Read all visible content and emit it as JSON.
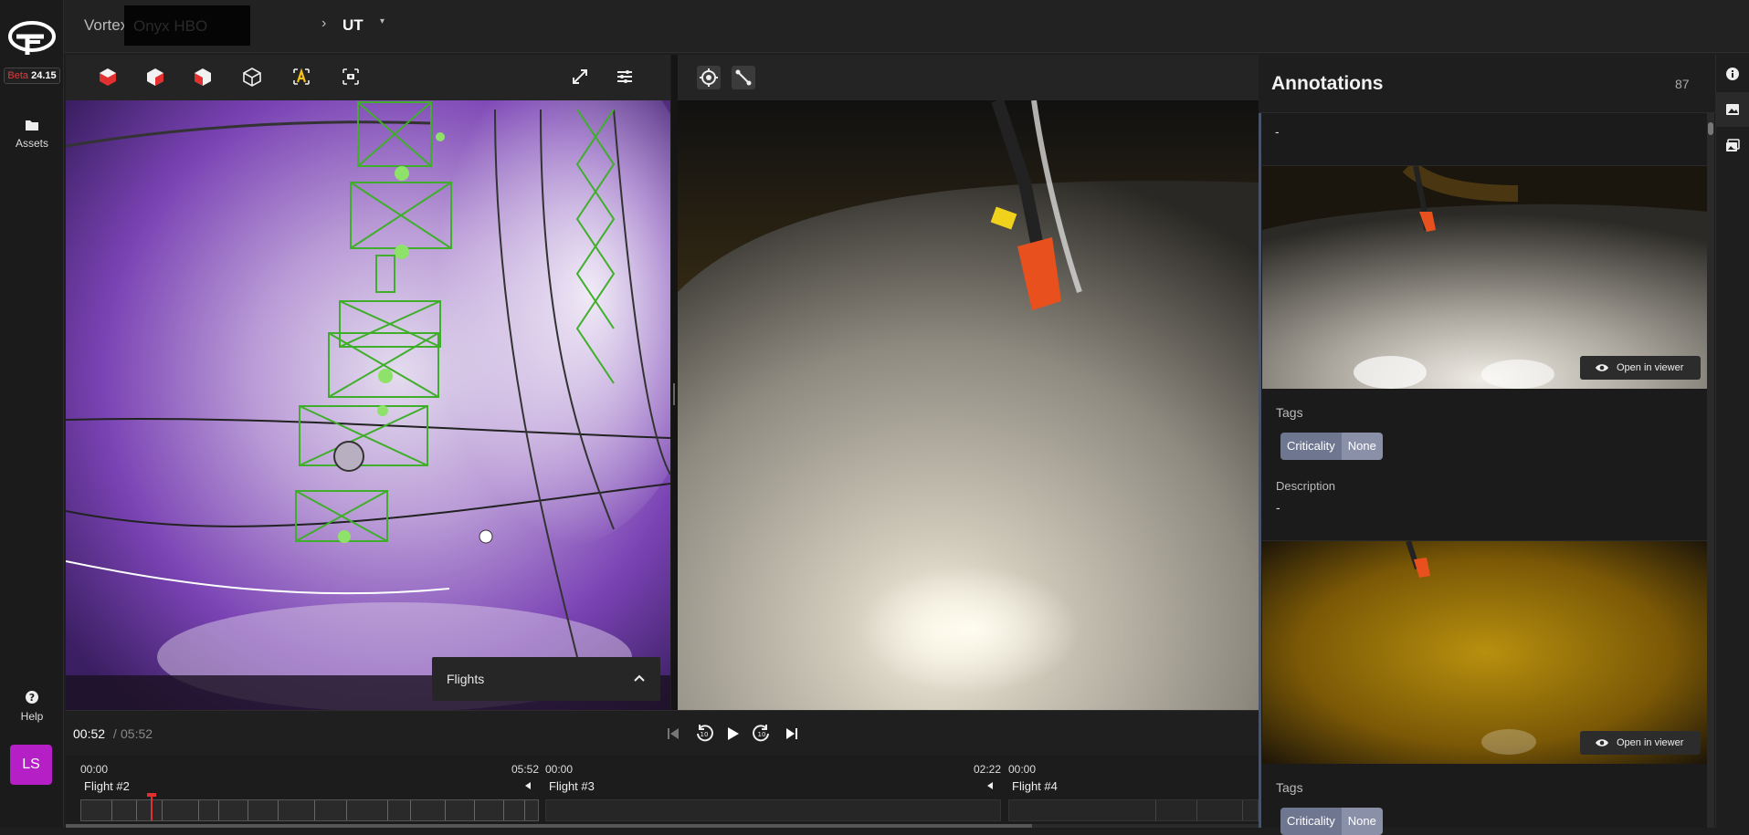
{
  "app": {
    "beta_label": "Beta",
    "version": "24.15"
  },
  "nav": {
    "assets_label": "Assets",
    "help_label": "Help",
    "avatar_initials": "LS"
  },
  "breadcrumb": {
    "item1": "Vortex",
    "item2": "Onyx HBO",
    "item3": "UT"
  },
  "viewer": {
    "flights_panel_label": "Flights"
  },
  "playback": {
    "current_time": "00:52",
    "separator": " / ",
    "total_time": "05:52"
  },
  "timeline": {
    "tracks": [
      {
        "start": "00:00",
        "end": "05:52",
        "name": "Flight #2"
      },
      {
        "start": "00:00",
        "end": "02:22",
        "name": "Flight #3"
      },
      {
        "start": "00:00",
        "end": "",
        "name": "Flight #4"
      }
    ]
  },
  "annotations": {
    "title": "Annotations",
    "count": "87",
    "top_dash": "-",
    "open_in_viewer": "Open in viewer",
    "tags_label": "Tags",
    "tag_key": "Criticality",
    "tag_value": "None",
    "description_label": "Description",
    "description_value": "-"
  },
  "colors": {
    "accent_avatar": "#b51fc6",
    "beta_red": "#e03b3b",
    "tag_key_bg": "#6f7690",
    "tag_value_bg": "#8a90a8",
    "overlay_green": "#3fae2a"
  },
  "icons": [
    "logo-icon",
    "folder-icon",
    "help-icon",
    "cube-icon",
    "expand-icon",
    "sliders-icon",
    "target-icon",
    "measure-icon",
    "camera-icon",
    "eye-icon",
    "info-icon",
    "image-icon",
    "gallery-icon",
    "play-icon",
    "skip-back-icon",
    "skip-forward-icon",
    "rewind-10-icon",
    "forward-10-icon",
    "chevron-up-icon"
  ]
}
